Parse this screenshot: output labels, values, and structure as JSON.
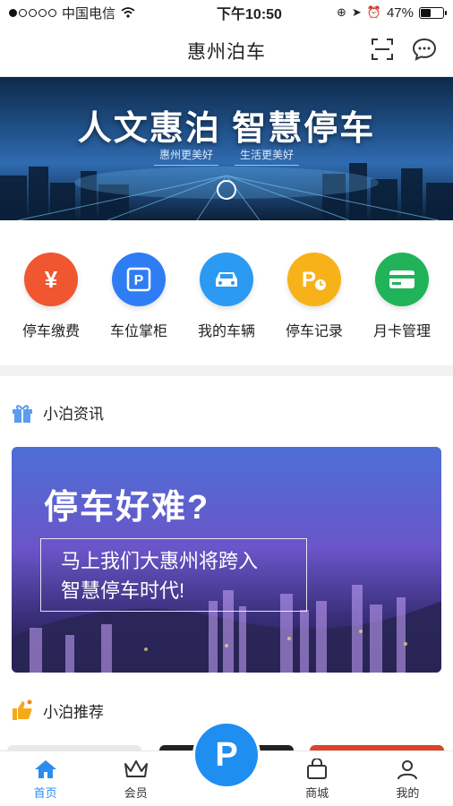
{
  "status": {
    "carrier": "中国电信",
    "time": "下午10:50",
    "battery": "47%",
    "battery_level": 0.47
  },
  "nav": {
    "title": "惠州泊车",
    "scan_icon": "scan-icon",
    "message_icon": "chat-bubble-icon"
  },
  "banner": {
    "headline": "人文惠泊  智慧停车",
    "sub_left": "惠州更美好",
    "sub_right": "生活更美好"
  },
  "quick_actions": [
    {
      "label": "停车缴费",
      "icon": "yen-icon",
      "glyph": "¥",
      "color": "#f0562f"
    },
    {
      "label": "车位掌柜",
      "icon": "parking-tag-icon",
      "glyph": "P",
      "color": "#2f7df5"
    },
    {
      "label": "我的车辆",
      "icon": "car-icon",
      "glyph": "",
      "color": "#2b9af3"
    },
    {
      "label": "停车记录",
      "icon": "parking-clock-icon",
      "glyph": "P",
      "color": "#f7b21a"
    },
    {
      "label": "月卡管理",
      "icon": "card-icon",
      "glyph": "",
      "color": "#21b35a"
    }
  ],
  "news_section": {
    "title": "小泊资讯",
    "icon": "gift-icon",
    "card_headline": "停车好难?",
    "card_line1": "马上我们大惠州将跨入",
    "card_line2": "智慧停车时代!"
  },
  "recommend_section": {
    "title": "小泊推荐",
    "icon": "thumbs-up-icon"
  },
  "tabbar": {
    "home": "首页",
    "member": "会员",
    "center": "P",
    "mall": "商城",
    "mine": "我的"
  },
  "colors": {
    "accent": "#2a8df0"
  }
}
